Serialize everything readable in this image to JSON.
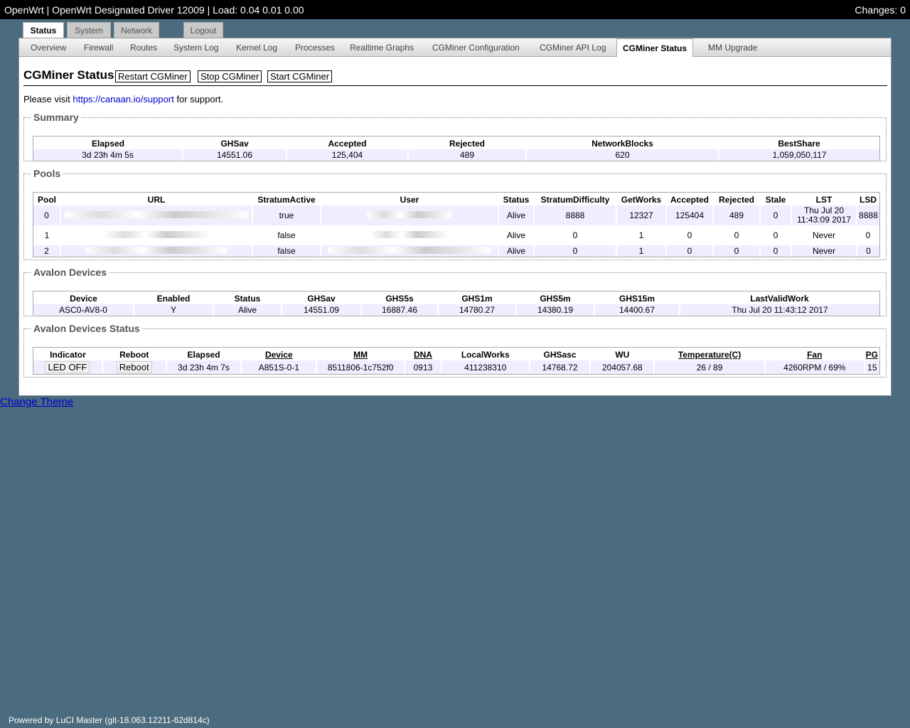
{
  "topbar": {
    "title": "OpenWrt | OpenWrt Designated Driver 12009 | Load: 0.04 0.01 0.00",
    "changes": "Changes: 0"
  },
  "main_tabs": [
    "Status",
    "System",
    "Network",
    "Logout"
  ],
  "sub_tabs": [
    "Overview",
    "Firewall",
    "Routes",
    "System Log",
    "Kernel Log",
    "Processes",
    "Realtime Graphs",
    "CGMiner Configuration",
    "CGMiner API Log",
    "CGMiner Status",
    "MM Upgrade"
  ],
  "page": {
    "title": "CGMiner Status",
    "restart_label": "Restart CGMiner",
    "stop_label": "Stop CGMiner",
    "start_label": "Start CGMiner",
    "visit_prefix": "Please visit",
    "visit_link": "https://canaan.io/support",
    "visit_suffix": "for support."
  },
  "summary": {
    "legend": "Summary",
    "headers": [
      "Elapsed",
      "GHSav",
      "Accepted",
      "Rejected",
      "NetworkBlocks",
      "BestShare"
    ],
    "row": [
      "3d 23h 4m 5s",
      "14551.06",
      "125,404",
      "489",
      "620",
      "1,059,050,117"
    ]
  },
  "pools": {
    "legend": "Pools",
    "headers": [
      "Pool",
      "URL",
      "StratumActive",
      "User",
      "Status",
      "StratumDifficulty",
      "GetWorks",
      "Accepted",
      "Rejected",
      "Stale",
      "LST",
      "LSD"
    ],
    "rows": [
      {
        "pool": "0",
        "active": "true",
        "status": "Alive",
        "diff": "8888",
        "getworks": "12327",
        "accepted": "125404",
        "rejected": "489",
        "stale": "0",
        "lst_1": "Thu Jul 20",
        "lst_2": "11:43:09 2017",
        "lsd": "8888"
      },
      {
        "pool": "1",
        "active": "false",
        "status": "Alive",
        "diff": "0",
        "getworks": "1",
        "accepted": "0",
        "rejected": "0",
        "stale": "0",
        "lst_1": "Never",
        "lst_2": "",
        "lsd": "0"
      },
      {
        "pool": "2",
        "active": "false",
        "status": "Alive",
        "diff": "0",
        "getworks": "1",
        "accepted": "0",
        "rejected": "0",
        "stale": "0",
        "lst_1": "Never",
        "lst_2": "",
        "lsd": "0"
      }
    ]
  },
  "devices": {
    "legend": "Avalon Devices",
    "headers": [
      "Device",
      "Enabled",
      "Status",
      "GHSav",
      "GHS5s",
      "GHS1m",
      "GHS5m",
      "GHS15m",
      "LastValidWork"
    ],
    "row": [
      "ASC0-AV8-0",
      "Y",
      "Alive",
      "14551.09",
      "16887.46",
      "14780.27",
      "14380.19",
      "14400.67",
      "Thu Jul 20 11:43:12 2017"
    ]
  },
  "dev_status": {
    "legend": "Avalon Devices Status",
    "headers": [
      "Indicator",
      "Reboot",
      "Elapsed",
      "Device",
      "MM",
      "DNA",
      "LocalWorks",
      "GHSasc",
      "WU",
      "Temperature(C)",
      "Fan",
      "PG"
    ],
    "led_label": "LED OFF",
    "reboot_label": "Reboot",
    "row": [
      "3d 23h 4m 7s",
      "A851S-0-1",
      "8511806-1c752f0",
      "0913",
      "411238310",
      "14768.72",
      "204057.68",
      "26 / 89",
      "4260RPM / 69%",
      "15"
    ]
  },
  "change_theme": "Change Theme",
  "footer": "Powered by LuCI Master (git-18.063.12211-62d814c)"
}
